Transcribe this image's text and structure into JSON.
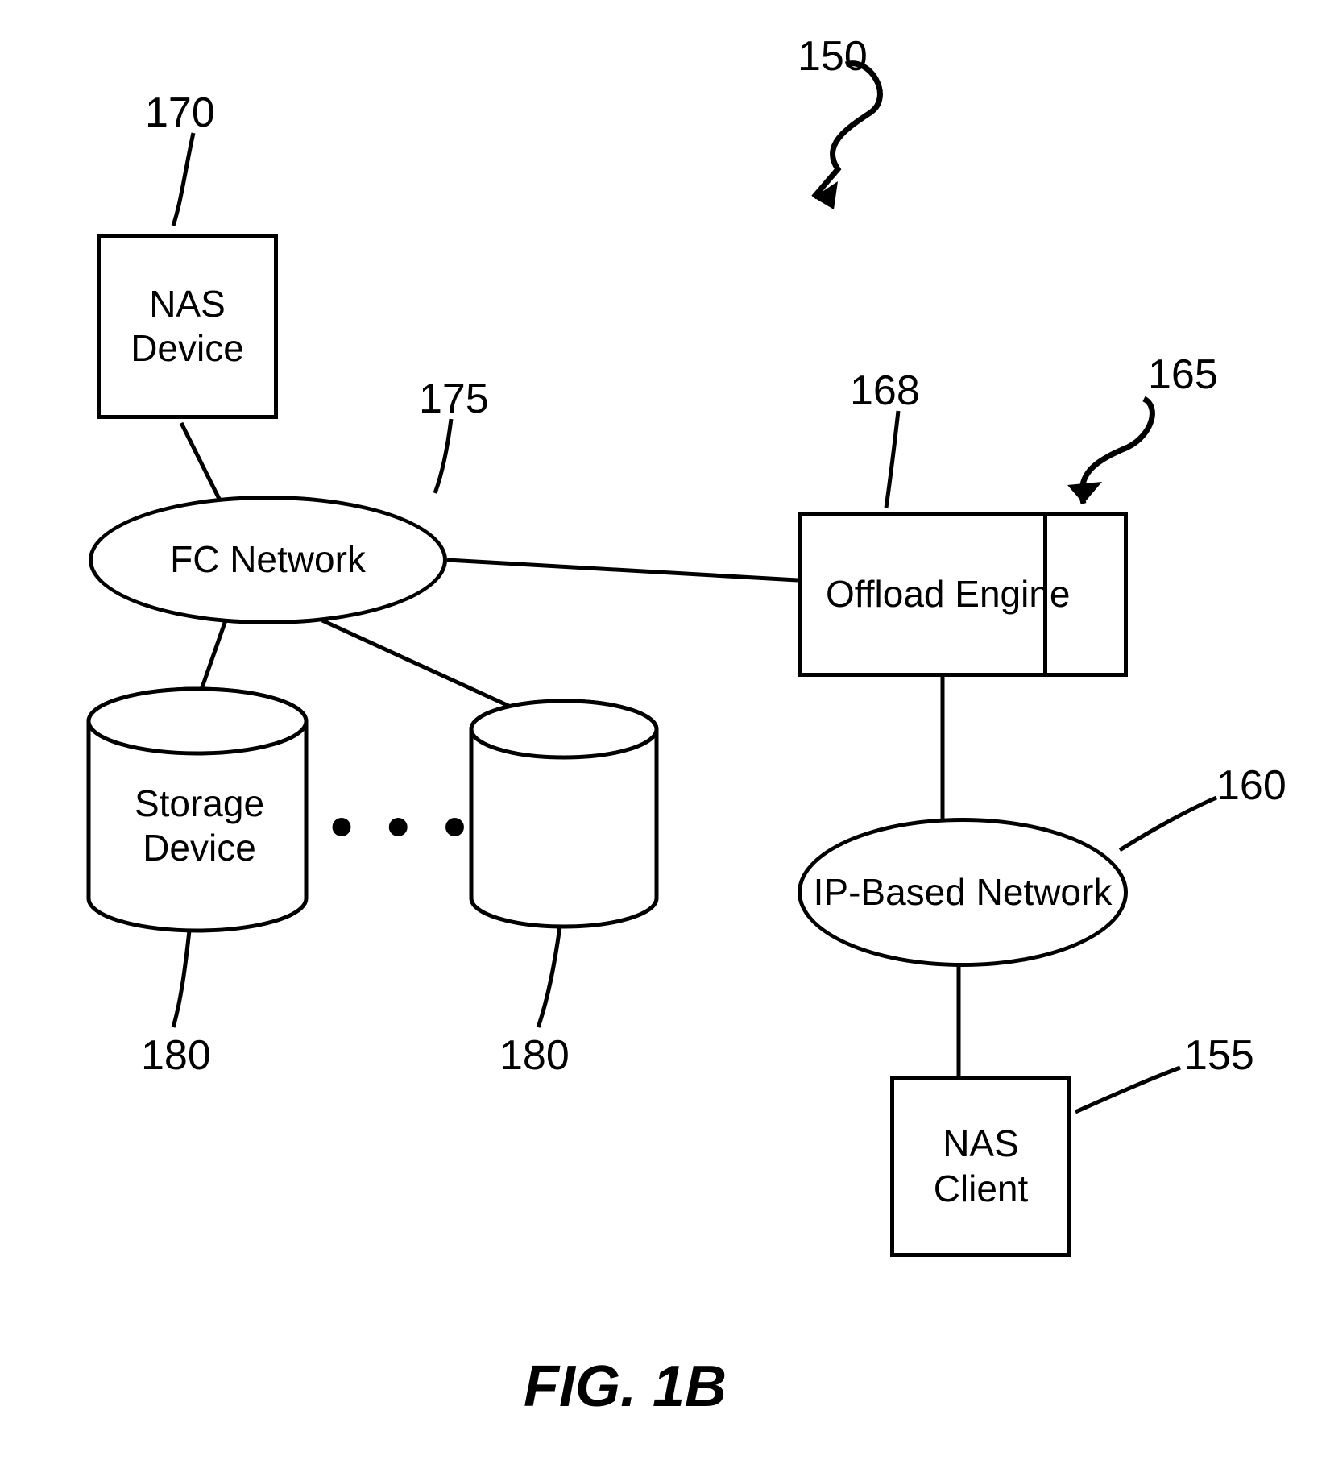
{
  "labels": {
    "ref150": "150",
    "ref170": "170",
    "ref175": "175",
    "ref168": "168",
    "ref165": "165",
    "ref180a": "180",
    "ref180b": "180",
    "ref160": "160",
    "ref155": "155"
  },
  "nodes": {
    "nas_device": "NAS\nDevice",
    "fc_network": "FC Network",
    "offload_engine": "Offload\nEngine",
    "storage_device": "Storage\nDevice",
    "ip_network": "IP-Based\nNetwork",
    "nas_client": "NAS\nClient"
  },
  "dots": "• • •",
  "caption": "FIG. 1B"
}
